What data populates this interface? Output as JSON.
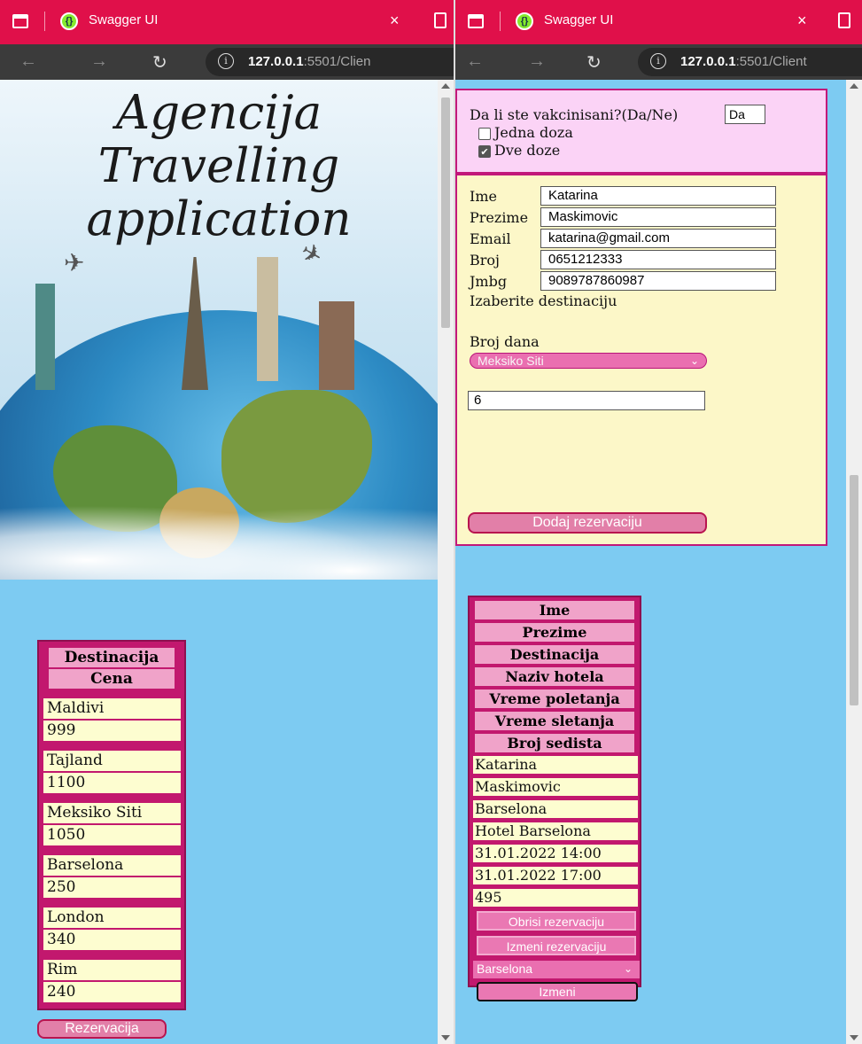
{
  "browser": {
    "tab_title": "Swagger UI",
    "close_glyph": "×",
    "url_host": "127.0.0.1",
    "url_rest_left": ":5501/Clien",
    "url_rest_right": ":5501/Client",
    "info_glyph": "i"
  },
  "hero": {
    "line1": "Agencija",
    "line2": "Travelling",
    "line3": "application"
  },
  "destinations": {
    "headers": [
      "Destinacija",
      "Cena"
    ],
    "rows": [
      {
        "name": "Maldivi",
        "price": "999"
      },
      {
        "name": "Tajland",
        "price": "1100"
      },
      {
        "name": "Meksiko Siti",
        "price": "1050"
      },
      {
        "name": "Barselona",
        "price": "250"
      },
      {
        "name": "London",
        "price": "340"
      },
      {
        "name": "Rim",
        "price": "240"
      }
    ],
    "button": "Rezervacija"
  },
  "vaccine": {
    "question": "Da li ste vakcinisani?(Da/Ne)",
    "answer": "Da",
    "option1": "Jedna doza",
    "option1_checked": false,
    "option2": "Dve doze",
    "option2_checked": true
  },
  "form": {
    "fields": [
      {
        "label": "Ime",
        "value": "Katarina"
      },
      {
        "label": "Prezime",
        "value": "Maskimovic"
      },
      {
        "label": "Email",
        "value": "katarina@gmail.com"
      },
      {
        "label": "Broj",
        "value": "0651212333"
      },
      {
        "label": "Jmbg",
        "value": "9089787860987"
      }
    ],
    "dest_label": "Izaberite destinaciju",
    "days_label": "Broj dana",
    "dest_selected": "Meksiko Siti",
    "days_value": "6",
    "add_button": "Dodaj rezervaciju"
  },
  "reservation": {
    "headers": [
      "Ime",
      "Prezime",
      "Destinacija",
      "Naziv hotela",
      "Vreme poletanja",
      "Vreme sletanja",
      "Broj sedista"
    ],
    "values": [
      "Katarina",
      "Maskimovic",
      "Barselona",
      "Hotel Barselona",
      "31.01.2022 14:00",
      "31.01.2022 17:00",
      "495"
    ],
    "delete_button": "Obrisi rezervaciju",
    "edit_button": "Izmeni rezervaciju",
    "select_value": "Barselona",
    "apply_button": "Izmeni"
  },
  "colors": {
    "tab_bar": "#e0104a",
    "page_bg": "#7dcbf2",
    "table_border": "#c2186e",
    "header_cell": "#f0a3c9",
    "data_cell": "#fdfdd0",
    "button_pink": "#e27fa8"
  }
}
